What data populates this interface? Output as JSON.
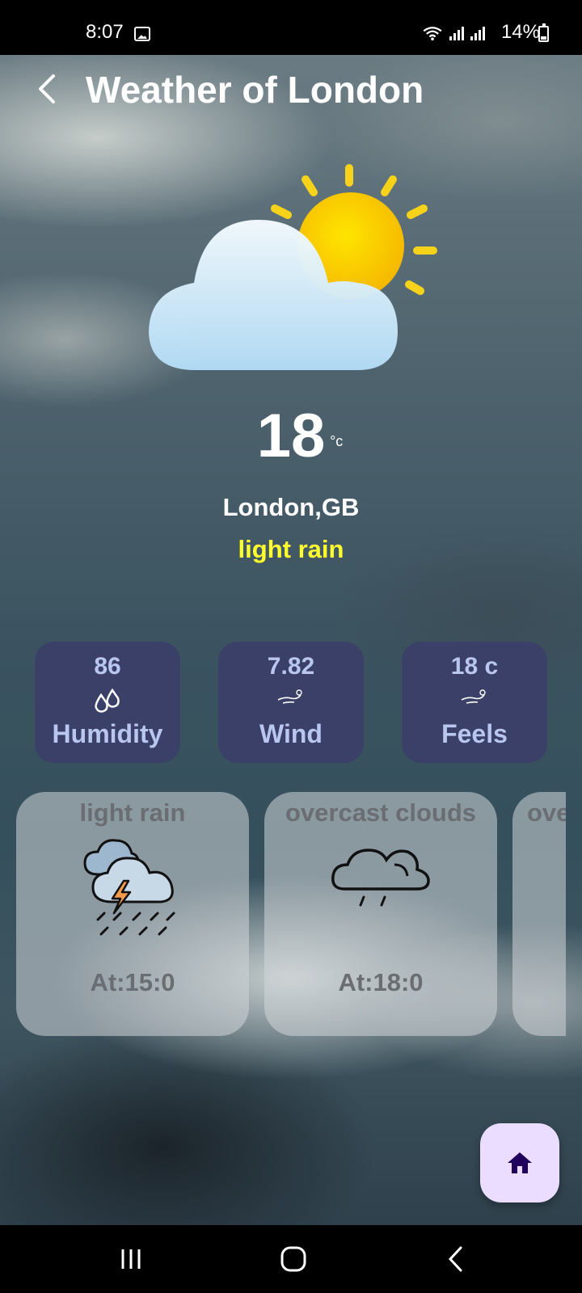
{
  "status_bar": {
    "time": "8:07",
    "battery": "14%"
  },
  "header": {
    "title": "Weather of London"
  },
  "current": {
    "temperature": "18",
    "unit": "°c",
    "location": "London,GB",
    "condition": "light rain",
    "condition_color": "#ffff2d"
  },
  "stats": [
    {
      "value": "86",
      "label": "Humidity",
      "icon": "humidity-drops-icon"
    },
    {
      "value": "7.82",
      "label": "Wind",
      "icon": "wind-icon"
    },
    {
      "value": "18 c",
      "label": "Feels",
      "icon": "wind-icon"
    }
  ],
  "forecast": [
    {
      "condition": "light rain",
      "time": "At:15:0",
      "icon": "thunderstorm-rain-icon"
    },
    {
      "condition": "overcast clouds",
      "time": "At:18:0",
      "icon": "cloud-drizzle-icon"
    },
    {
      "condition": "ove",
      "time": "",
      "icon": ""
    }
  ],
  "colors": {
    "stat_card_bg": "#3a4068",
    "stat_text": "#b9c6ee",
    "fab_bg": "#eaddff",
    "fab_icon": "#21005d"
  }
}
